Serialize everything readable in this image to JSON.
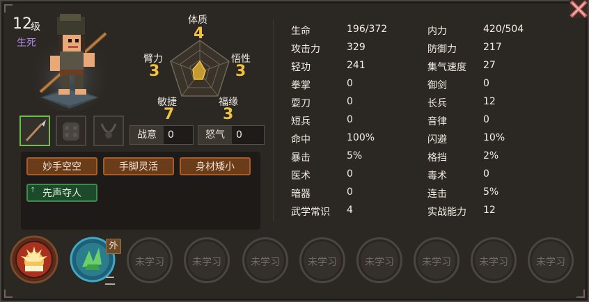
{
  "character": {
    "level": "12",
    "level_unit": "级",
    "title": "生死",
    "title_color": "#b08ce8"
  },
  "attributes": [
    {
      "key": "physique",
      "label": "体质",
      "value": "4"
    },
    {
      "key": "strength",
      "label": "臂力",
      "value": "3"
    },
    {
      "key": "insight",
      "label": "悟性",
      "value": "3"
    },
    {
      "key": "agility",
      "label": "敏捷",
      "value": "7"
    },
    {
      "key": "fortune",
      "label": "福缘",
      "value": "3"
    }
  ],
  "equipment_slots": [
    {
      "icon": "spear-icon",
      "active": true
    },
    {
      "icon": "armor-icon",
      "active": false
    },
    {
      "icon": "necklace-icon",
      "active": false
    }
  ],
  "fields": {
    "battle_will": {
      "label": "战意",
      "value": "0"
    },
    "rage": {
      "label": "怒气",
      "value": "0"
    }
  },
  "traits": [
    "妙手空空",
    "手脚灵活",
    "身材矮小"
  ],
  "special_trait": {
    "label": "先声夺人",
    "arrow": "↑"
  },
  "stats_left": [
    {
      "label": "生命",
      "value": "196/372"
    },
    {
      "label": "攻击力",
      "value": "329"
    },
    {
      "label": "轻功",
      "value": "241"
    },
    {
      "label": "拳掌",
      "value": "0"
    },
    {
      "label": "耍刀",
      "value": "0"
    },
    {
      "label": "短兵",
      "value": "0"
    },
    {
      "label": "命中",
      "value": "100%"
    },
    {
      "label": "暴击",
      "value": "5%"
    },
    {
      "label": "医术",
      "value": "0"
    },
    {
      "label": "暗器",
      "value": "0"
    },
    {
      "label": "武学常识",
      "value": "4"
    }
  ],
  "stats_right": [
    {
      "label": "内力",
      "value": "420/504"
    },
    {
      "label": "防御力",
      "value": "217"
    },
    {
      "label": "集气速度",
      "value": "27"
    },
    {
      "label": "御剑",
      "value": "0"
    },
    {
      "label": "长兵",
      "value": "12"
    },
    {
      "label": "音律",
      "value": "0"
    },
    {
      "label": "闪避",
      "value": "10%"
    },
    {
      "label": "格挡",
      "value": "2%"
    },
    {
      "label": "毒术",
      "value": "0"
    },
    {
      "label": "连击",
      "value": "5%"
    },
    {
      "label": "实战能力",
      "value": "12"
    }
  ],
  "skills": {
    "learned": [
      {
        "icon": "palm-strike-icon"
      },
      {
        "icon": "green-claw-icon",
        "badge": "外",
        "rank": "二"
      }
    ],
    "empty_label": "未学习",
    "empty_count": 8
  },
  "colors": {
    "accent_gold": "#f0c043",
    "trait_orange": "#a45d2b",
    "trait_green": "#3f8a4d"
  }
}
